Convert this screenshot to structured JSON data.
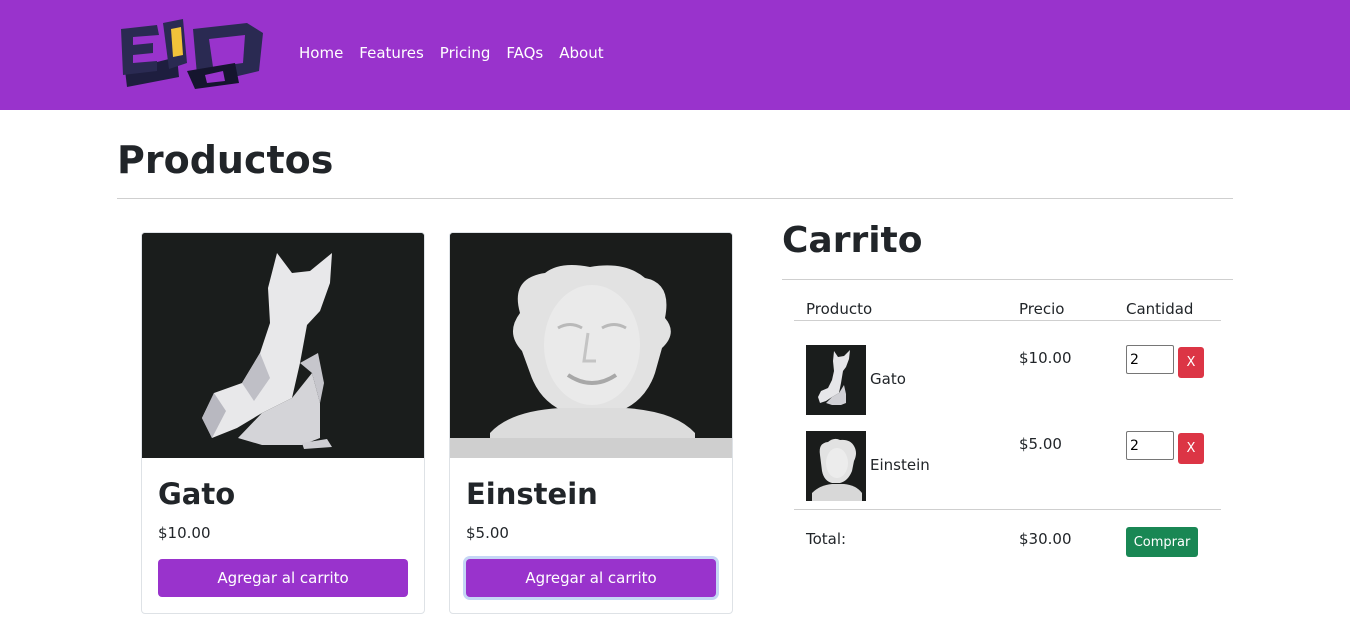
{
  "nav": {
    "links": [
      "Home",
      "Features",
      "Pricing",
      "FAQs",
      "About"
    ]
  },
  "page": {
    "title": "Productos"
  },
  "products": [
    {
      "name": "Gato",
      "price": "$10.00",
      "button": "Agregar al carrito",
      "image": "cat-sculpture"
    },
    {
      "name": "Einstein",
      "price": "$5.00",
      "button": "Agregar al carrito",
      "image": "einstein-bust"
    }
  ],
  "cart": {
    "title": "Carrito",
    "headers": {
      "product": "Producto",
      "price": "Precio",
      "quantity": "Cantidad"
    },
    "items": [
      {
        "name": "Gato",
        "price": "$10.00",
        "quantity": "2",
        "remove": "X"
      },
      {
        "name": "Einstein",
        "price": "$5.00",
        "quantity": "2",
        "remove": "X"
      }
    ],
    "total_label": "Total:",
    "total_value": "$30.00",
    "buy_label": "Comprar"
  },
  "colors": {
    "brand": "#9933cc",
    "danger": "#dc3545",
    "success": "#198754"
  }
}
